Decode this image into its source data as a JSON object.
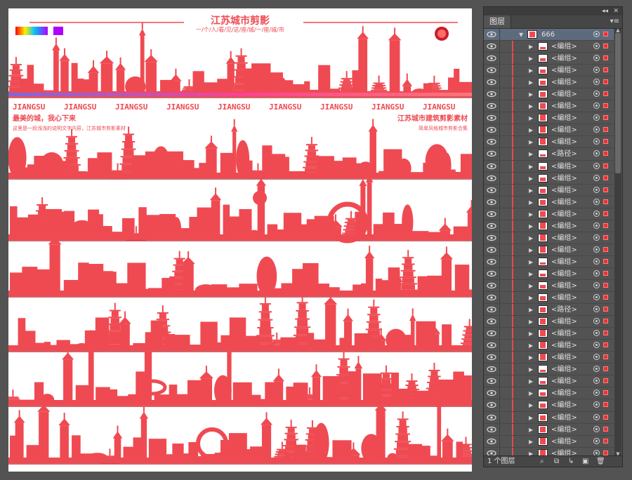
{
  "artboard": {
    "title": "江苏城市剪影",
    "subtitle": "一/个/人/看/见/这/座/城/一/座/城/市",
    "jiangsu_text": "JIANGSU",
    "left_tagline": "最美的城，我心下来",
    "left_small": "这里是一段浅浅的说明文字内容，江苏城市剪影素材",
    "right_tagline": "江苏城市建筑剪影素材",
    "right_small": "简单风格城市剪影合集",
    "art_color": "#ef4a52"
  },
  "layers_panel": {
    "tab_label": "图层",
    "collapse_label": "◂◂",
    "close_label": "✕",
    "menu_label": "▾≡",
    "top_layer": {
      "name": "666",
      "expand": "▼"
    },
    "items": [
      {
        "name": "<编组>"
      },
      {
        "name": "<编组>"
      },
      {
        "name": "<编组>"
      },
      {
        "name": "<编组>"
      },
      {
        "name": "<编组>"
      },
      {
        "name": "<编组>"
      },
      {
        "name": "<编组>"
      },
      {
        "name": "<编组>"
      },
      {
        "name": "<编组>"
      },
      {
        "name": "<路径>"
      },
      {
        "name": "<编组>"
      },
      {
        "name": "<编组>"
      },
      {
        "name": "<编组>"
      },
      {
        "name": "<编组>"
      },
      {
        "name": "<编组>"
      },
      {
        "name": "<编组>"
      },
      {
        "name": "<编组>"
      },
      {
        "name": "<编组>"
      },
      {
        "name": "<编组>"
      },
      {
        "name": "<编组>"
      },
      {
        "name": "<编组>"
      },
      {
        "name": "<编组>"
      },
      {
        "name": "<路径>"
      },
      {
        "name": "<编组>"
      },
      {
        "name": "<编组>"
      },
      {
        "name": "<编组>"
      },
      {
        "name": "<编组>"
      },
      {
        "name": "<编组>"
      },
      {
        "name": "<编组>"
      },
      {
        "name": "<编组>"
      },
      {
        "name": "<编组>"
      },
      {
        "name": "<编组>"
      },
      {
        "name": "<编组>"
      },
      {
        "name": "<编组>"
      },
      {
        "name": "<编组>"
      }
    ],
    "footer": {
      "layer_count": "1 个图层",
      "icons": [
        "search-icon",
        "collect-icon",
        "new-sublayer-icon",
        "new-layer-icon",
        "delete-icon"
      ]
    }
  }
}
